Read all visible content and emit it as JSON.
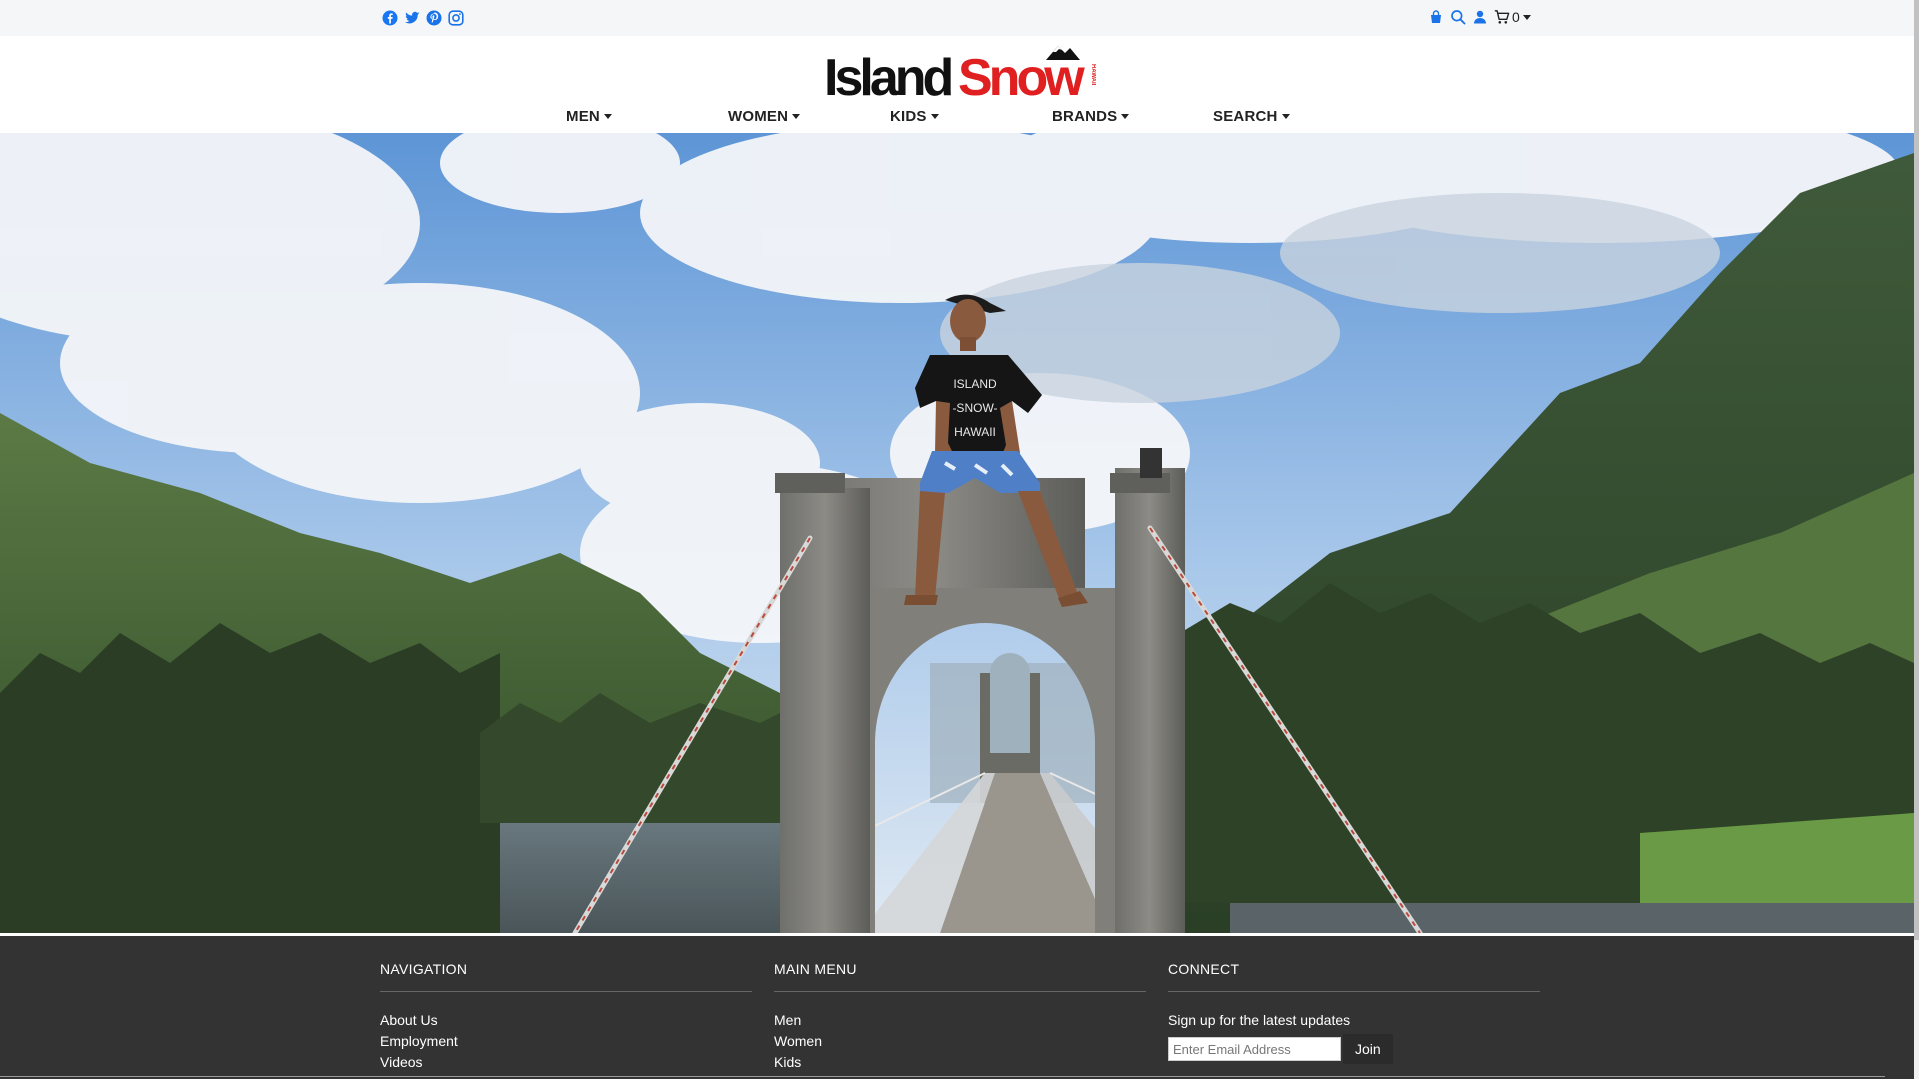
{
  "topbar": {
    "social": [
      {
        "icon": "facebook-icon",
        "color": "#1877f2"
      },
      {
        "icon": "twitter-icon",
        "color": "#1d9bf0"
      },
      {
        "icon": "pinterest-icon",
        "color": "#1a73e8"
      },
      {
        "icon": "instagram-icon",
        "color": "#1a73e8"
      }
    ],
    "utility_icons": [
      "store-icon",
      "search-icon",
      "user-icon",
      "cart-icon"
    ],
    "cart_count": "0"
  },
  "logo": {
    "word1": "Island",
    "word2": "Snow",
    "tag": "HAWAII"
  },
  "nav": [
    {
      "label": "MEN"
    },
    {
      "label": "WOMEN"
    },
    {
      "label": "KIDS"
    },
    {
      "label": "BRANDS"
    },
    {
      "label": "SEARCH"
    }
  ],
  "hero": {
    "shirt_text": [
      "ISLAND",
      "-SNOW-",
      "HAWAII"
    ]
  },
  "footer": {
    "navigation": {
      "heading": "NAVIGATION",
      "links": [
        "About Us",
        "Employment",
        "Videos"
      ]
    },
    "main_menu": {
      "heading": "MAIN MENU",
      "links": [
        "Men",
        "Women",
        "Kids"
      ]
    },
    "connect": {
      "heading": "CONNECT",
      "signup_text": "Sign up for the latest updates",
      "email_placeholder": "Enter Email Address",
      "join_label": "Join"
    }
  },
  "colors": {
    "accent_blue": "#1a73e8",
    "logo_red": "#e02020",
    "footer_bg": "#333333",
    "topbar_bg": "#f5f6f8"
  }
}
